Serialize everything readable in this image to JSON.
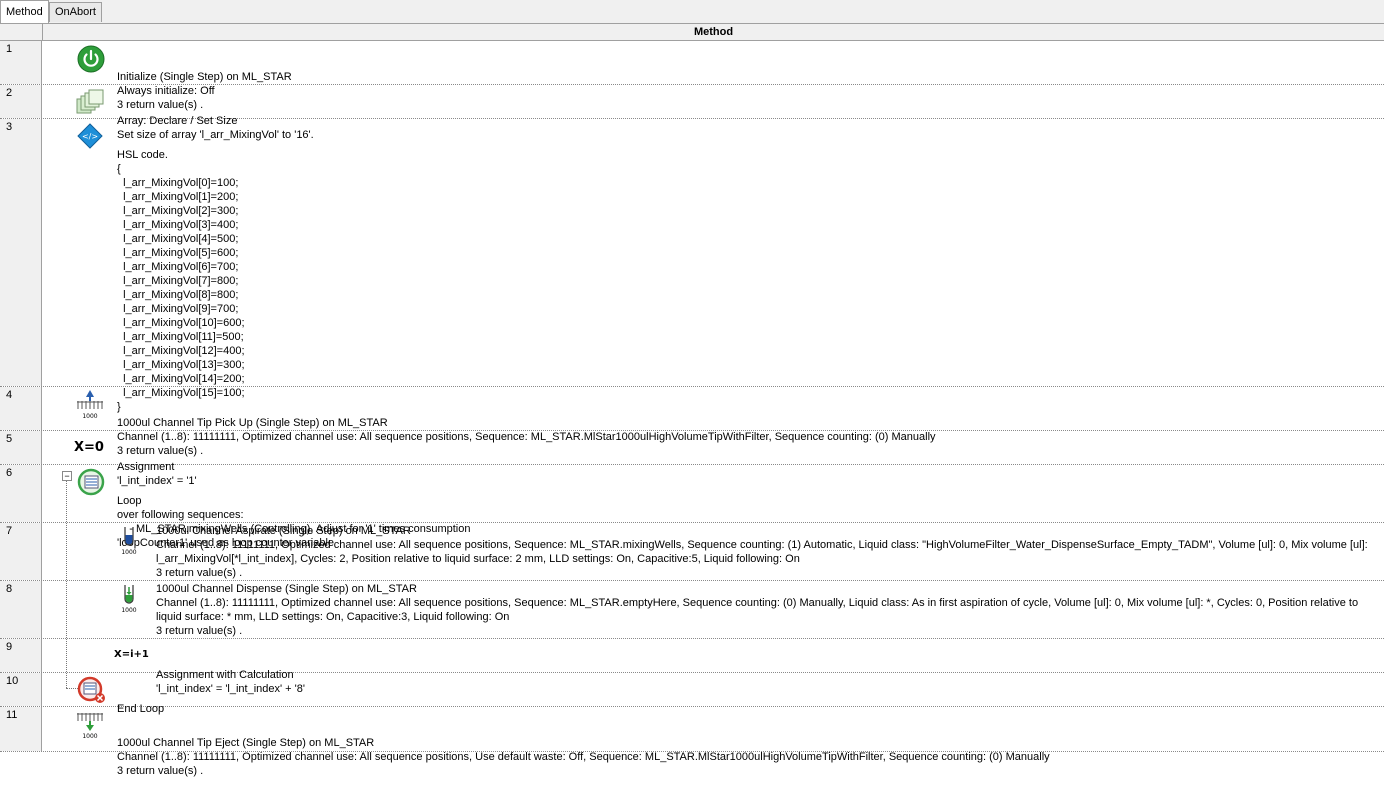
{
  "tabs": [
    {
      "label": "Method",
      "active": true
    },
    {
      "label": "OnAbort",
      "active": false
    }
  ],
  "grid": {
    "header": "Method"
  },
  "steps": [
    {
      "num": "1",
      "icon": "power-icon",
      "lines": [
        "Initialize (Single Step) on ML_STAR",
        "Always initialize: Off",
        "3 return value(s) ."
      ]
    },
    {
      "num": "2",
      "icon": "array-icon",
      "lines": [
        "Array: Declare / Set Size",
        "Set size of array 'l_arr_MixingVol' to '16'."
      ]
    },
    {
      "num": "3",
      "icon": "hsl-code-icon",
      "lines": [
        "HSL code.",
        "{",
        "  l_arr_MixingVol[0]=100;",
        "  l_arr_MixingVol[1]=200;",
        "  l_arr_MixingVol[2]=300;",
        "  l_arr_MixingVol[3]=400;",
        "  l_arr_MixingVol[4]=500;",
        "  l_arr_MixingVol[5]=600;",
        "  l_arr_MixingVol[6]=700;",
        "  l_arr_MixingVol[7]=800;",
        "  l_arr_MixingVol[8]=800;",
        "  l_arr_MixingVol[9]=700;",
        "  l_arr_MixingVol[10]=600;",
        "  l_arr_MixingVol[11]=500;",
        "  l_arr_MixingVol[12]=400;",
        "  l_arr_MixingVol[13]=300;",
        "  l_arr_MixingVol[14]=200;",
        "  l_arr_MixingVol[15]=100;",
        "}"
      ]
    },
    {
      "num": "4",
      "icon": "tip-pickup-icon",
      "lines": [
        "1000ul Channel Tip Pick Up (Single Step) on ML_STAR",
        "Channel (1..8): 11111111, Optimized channel use: All sequence positions, Sequence: ML_STAR.MlStar1000ulHighVolumeTipWithFilter, Sequence counting: (0) Manually",
        "3 return value(s) ."
      ]
    },
    {
      "num": "5",
      "icon": "assignment-icon",
      "icon_text": "X=0",
      "lines": [
        "Assignment",
        "'l_int_index' = '1'"
      ]
    },
    {
      "num": "6",
      "icon": "loop-icon",
      "lines": [
        "Loop",
        "over following sequences:",
        "    - ML_STAR.mixingWells (Controlling), Adjust for '1' times consumption",
        "'loopCounter1' used as loop counter variable"
      ]
    },
    {
      "num": "7",
      "icon": "aspirate-icon",
      "text": "1000ul Channel Aspirate (Single Step) on ML_STAR\nChannel (1..8): 11111111, Optimized channel use: All sequence positions, Sequence: ML_STAR.mixingWells, Sequence counting: (1) Automatic, Liquid class: \"HighVolumeFilter_Water_DispenseSurface_Empty_TADM\", Volume [ul]: 0, Mix volume [ul]: l_arr_MixingVol[*l_int_index], Cycles: 2, Position relative to liquid surface: 2 mm, LLD settings: On, Capacitive:5, Liquid following: On\n3 return value(s) ."
    },
    {
      "num": "8",
      "icon": "dispense-icon",
      "text": "1000ul Channel Dispense (Single Step) on ML_STAR\nChannel (1..8): 11111111, Optimized channel use: All sequence positions, Sequence: ML_STAR.emptyHere, Sequence counting: (0) Manually, Liquid class: As in first aspiration of cycle, Volume [ul]: 0, Mix volume [ul]: *, Cycles: 0, Position relative to liquid surface: * mm, LLD settings: On, Capacitive:3, Liquid following: On\n3 return value(s) ."
    },
    {
      "num": "9",
      "icon": "calc-assignment-icon",
      "icon_text": "X=i+1",
      "lines": [
        "Assignment with Calculation",
        "'l_int_index' = 'l_int_index' + '8'"
      ]
    },
    {
      "num": "10",
      "icon": "end-loop-icon",
      "lines": [
        "End Loop"
      ]
    },
    {
      "num": "11",
      "icon": "tip-eject-icon",
      "lines": [
        "1000ul Channel Tip Eject (Single Step) on ML_STAR",
        "Channel (1..8): 11111111, Optimized channel use: All sequence positions, Use default waste: Off, Sequence: ML_STAR.MlStar1000ulHighVolumeTipWithFilter, Sequence counting: (0) Manually",
        "3 return value(s) ."
      ]
    }
  ],
  "icon_labels": {
    "tip_volume": "1000"
  },
  "colors": {
    "header_bg": "#f0f0f0",
    "grid_line": "#a0a0a0",
    "power_green": "#2e9e3a",
    "hsl_blue": "#1e8fd8",
    "loop_green": "#3aa34a",
    "end_loop_red": "#d23a2a"
  }
}
